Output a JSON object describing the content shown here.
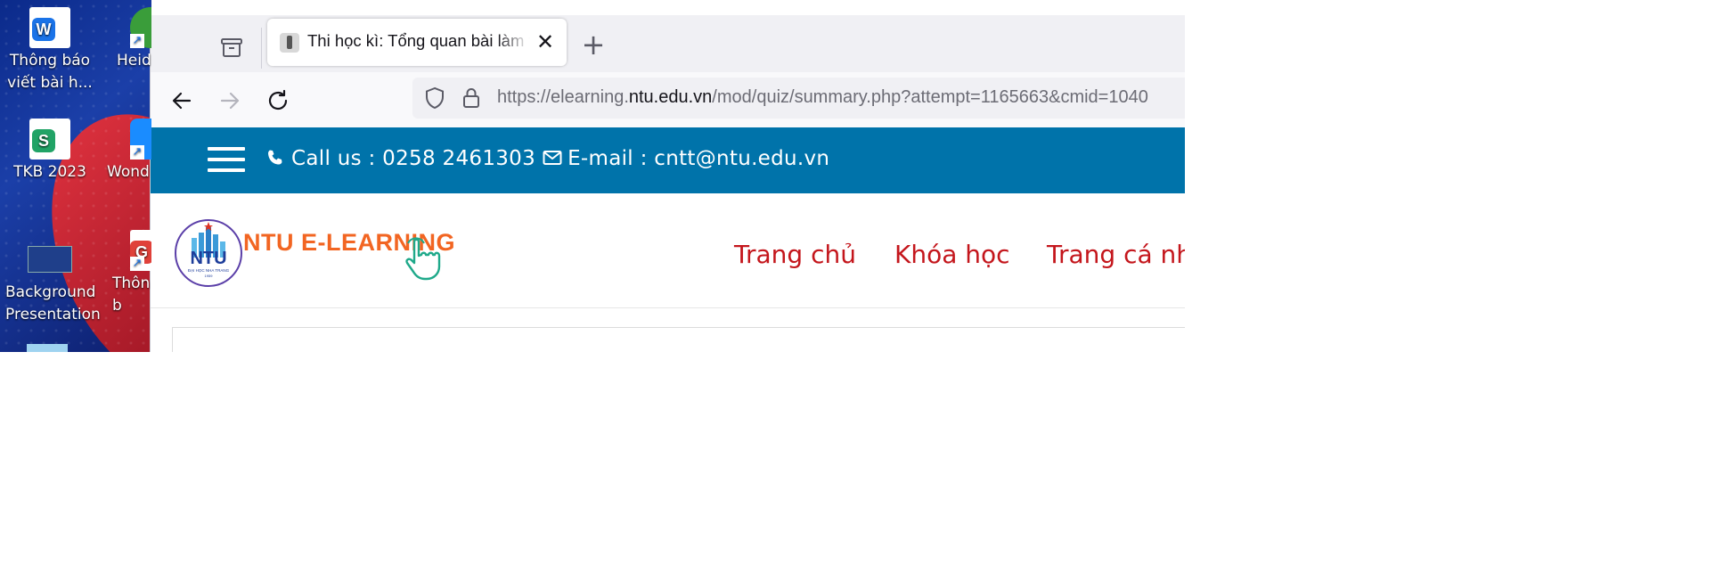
{
  "desktop": {
    "icons": [
      {
        "label": "Thông báo viết bài h...",
        "icon": "word-document-icon"
      },
      {
        "label": "Heid",
        "icon": "heidisql-shortcut-icon"
      },
      {
        "label": "TKB 2023",
        "icon": "spreadsheet-document-icon"
      },
      {
        "label": "Wond",
        "icon": "wondershare-shortcut-icon"
      },
      {
        "label": "Background Presentation",
        "icon": "presentation-thumbnail-icon"
      },
      {
        "label": "Thôn viết b",
        "icon": "document-shortcut-icon"
      }
    ]
  },
  "browser": {
    "tab": {
      "title": "Thi học kì: Tổng quan bài làm thử",
      "favicon": "quiz-favicon-icon"
    },
    "url": {
      "prefix": "https://elearning.",
      "host": "ntu.edu.vn",
      "path": "/mod/quiz/summary.php?attempt=1165663&cmid=1040"
    }
  },
  "page": {
    "topbar": {
      "phone_text": "Call us : 0258 2461303",
      "email_text": "E-mail : cntt@ntu.edu.vn",
      "background": "#0073aa"
    },
    "logo": {
      "text": "NTU E-LEARNING",
      "seal_text": "NTU",
      "seal_subtext": "ĐẠI HỌC NHA TRANG",
      "seal_year": "1959"
    },
    "menu": [
      "Trang chủ",
      "Khóa học",
      "Trang cá nhân"
    ],
    "menu_color": "#c4161c"
  }
}
